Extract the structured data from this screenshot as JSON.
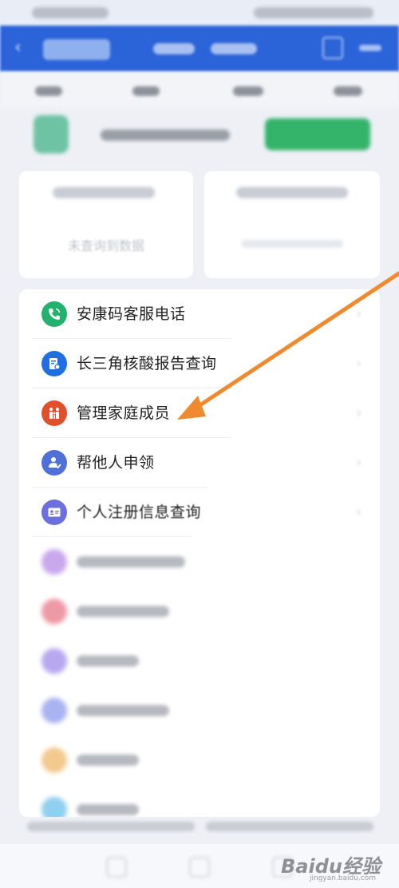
{
  "menu": {
    "items": [
      {
        "label": "安康码客服电话",
        "icon": "phone-icon",
        "color": "#23b26d"
      },
      {
        "label": "长三角核酸报告查询",
        "icon": "report-icon",
        "color": "#1f6fe0"
      },
      {
        "label": "管理家庭成员",
        "icon": "family-icon",
        "color": "#e0502b"
      },
      {
        "label": "帮他人申领",
        "icon": "user-check-icon",
        "color": "#4f6fd9"
      },
      {
        "label": "个人注册信息查询",
        "icon": "id-card-icon",
        "color": "#6b6fe0"
      }
    ]
  },
  "cards": {
    "left_empty_text": "未查询到数据"
  },
  "watermark": {
    "brand": "Baidu经验",
    "site": "jingyan.baidu.com"
  },
  "colors": {
    "header": "#2b63d8",
    "arrow": "#f08a2e"
  }
}
